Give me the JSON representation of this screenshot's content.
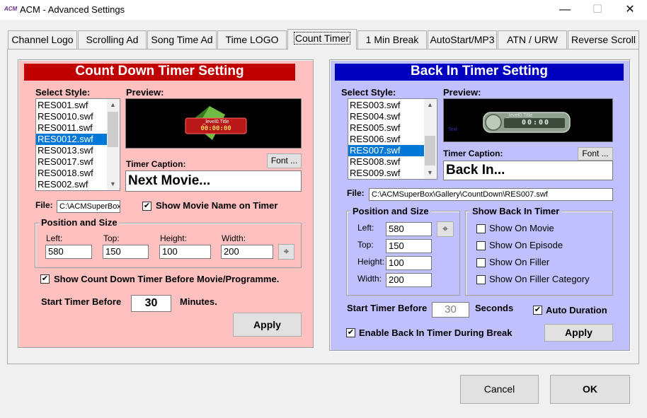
{
  "window": {
    "title": "ACM - Advanced Settings",
    "app_icon_text": "ACM"
  },
  "tabs": [
    {
      "label": "Channel Logo"
    },
    {
      "label": "Scrolling Ad"
    },
    {
      "label": "Song Time Ad"
    },
    {
      "label": "Time LOGO"
    },
    {
      "label": "Count Timer"
    },
    {
      "label": "1 Min Break"
    },
    {
      "label": "AutoStart/MP3"
    },
    {
      "label": "ATN / URW"
    },
    {
      "label": "Reverse Scroll"
    }
  ],
  "countdown": {
    "title": "Count Down Timer Setting",
    "select_style_label": "Select Style:",
    "preview_label": "Preview:",
    "styles": [
      "RES001.swf",
      "RES0010.swf",
      "RES0011.swf",
      "RES0012.swf",
      "RES0013.swf",
      "RES0017.swf",
      "RES0018.swf",
      "RES002.swf"
    ],
    "selected_style": "RES0012.swf",
    "preview_title": "_level0.Title",
    "preview_time": "00:00:00",
    "font_button": "Font ...",
    "timer_caption_label": "Timer Caption:",
    "timer_caption": "Next Movie...",
    "file_label": "File:",
    "file_value": "C:\\ACMSuperBox",
    "show_movie_name_label": "Show Movie Name on Timer",
    "show_movie_name_checked": true,
    "position_legend": "Position and Size",
    "left_label": "Left:",
    "left_value": "580",
    "top_label": "Top:",
    "top_value": "150",
    "height_label": "Height:",
    "height_value": "100",
    "width_label": "Width:",
    "width_value": "200",
    "show_before_label": "Show Count Down Timer Before Movie/Programme.",
    "show_before_checked": true,
    "start_before_label": "Start Timer Before",
    "start_before_value": "30",
    "minutes_label": "Minutes.",
    "apply_button": "Apply"
  },
  "backin": {
    "title": "Back In Timer Setting",
    "select_style_label": "Select Style:",
    "preview_label": "Preview:",
    "styles": [
      "RES003.swf",
      "RES004.swf",
      "RES005.swf",
      "RES006.swf",
      "RES007.swf",
      "RES008.swf",
      "RES009.swf"
    ],
    "selected_style": "RES007.swf",
    "preview_title": "_level0.Title",
    "preview_time": "00:00",
    "preview_small": "Text",
    "font_button": "Font ...",
    "timer_caption_label": "Timer Caption:",
    "timer_caption": "Back In...",
    "file_label": "File:",
    "file_value": "C:\\ACMSuperBox\\Gallery\\CountDown\\RES007.swf",
    "position_legend": "Position and Size",
    "left_label": "Left:",
    "left_value": "580",
    "top_label": "Top:",
    "top_value": "150",
    "height_label": "Height:",
    "height_value": "100",
    "width_label": "Width:",
    "width_value": "200",
    "show_legend": "Show Back In Timer",
    "show_on_movie": "Show On Movie",
    "show_on_episode": "Show On Episode",
    "show_on_filler": "Show On Filler",
    "show_on_filler_category": "Show On Filler Category",
    "start_before_label": "Start Timer Before",
    "start_before_value": "30",
    "seconds_label": "Seconds",
    "auto_duration_label": "Auto Duration",
    "auto_duration_checked": true,
    "enable_label": "Enable Back In Timer During Break",
    "enable_checked": true,
    "apply_button": "Apply"
  },
  "footer": {
    "cancel_button": "Cancel",
    "ok_button": "OK"
  },
  "colors": {
    "countdown_bg": "#ffc0c0",
    "countdown_header": "#c00000",
    "backin_bg": "#c0c0ff",
    "backin_header": "#0000c0",
    "selection": "#0078d7"
  }
}
